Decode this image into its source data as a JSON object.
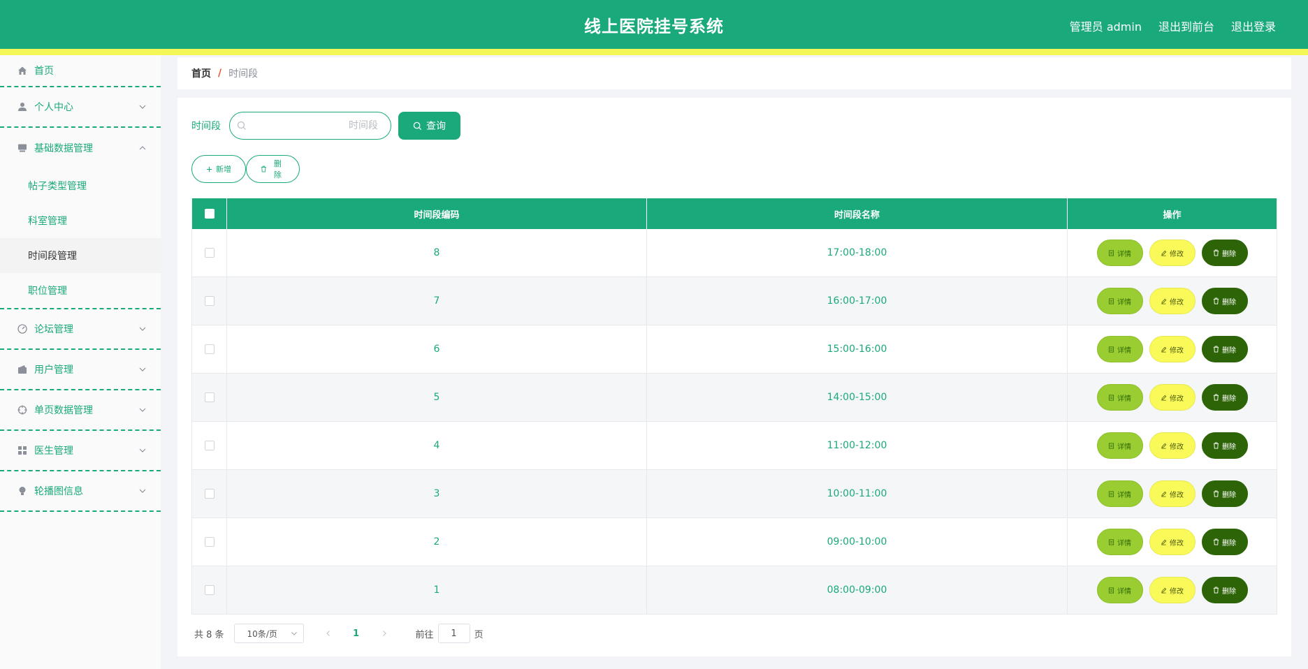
{
  "header": {
    "title": "线上医院挂号系统",
    "admin_label": "管理员 admin",
    "back_to_front": "退出到前台",
    "logout": "退出登录",
    "colors": {
      "primary": "#1aa97b",
      "strip": "#f5f758"
    }
  },
  "sidebar": {
    "items": [
      {
        "label": "首页",
        "icon": "home-icon"
      },
      {
        "label": "个人中心",
        "icon": "user-icon"
      },
      {
        "label": "基础数据管理",
        "icon": "archive-icon",
        "expanded": true,
        "children": [
          {
            "label": "帖子类型管理"
          },
          {
            "label": "科室管理"
          },
          {
            "label": "时间段管理",
            "active": true
          },
          {
            "label": "职位管理"
          }
        ]
      },
      {
        "label": "论坛管理",
        "icon": "gauge-icon"
      },
      {
        "label": "用户管理",
        "icon": "wallet-icon"
      },
      {
        "label": "单页数据管理",
        "icon": "crosshair-icon"
      },
      {
        "label": "医生管理",
        "icon": "grid-icon"
      },
      {
        "label": "轮播图信息",
        "icon": "bulb-icon"
      }
    ]
  },
  "breadcrumb": {
    "home": "首页",
    "separator": "/",
    "current": "时间段"
  },
  "search": {
    "label": "时间段",
    "placeholder": "时间段",
    "value": "",
    "query_button": "查询"
  },
  "actions": {
    "add": "新增",
    "delete": "删除"
  },
  "table": {
    "columns": [
      "时间段编码",
      "时间段名称",
      "操作"
    ],
    "rows": [
      {
        "code": "8",
        "name": "17:00-18:00"
      },
      {
        "code": "7",
        "name": "16:00-17:00"
      },
      {
        "code": "6",
        "name": "15:00-16:00"
      },
      {
        "code": "5",
        "name": "14:00-15:00"
      },
      {
        "code": "4",
        "name": "11:00-12:00"
      },
      {
        "code": "3",
        "name": "10:00-11:00"
      },
      {
        "code": "2",
        "name": "09:00-10:00"
      },
      {
        "code": "1",
        "name": "08:00-09:00"
      }
    ],
    "row_buttons": {
      "detail": "详情",
      "edit": "修改",
      "delete": "删除"
    }
  },
  "pagination": {
    "total": "共 8 条",
    "page_size": "10条/页",
    "current_page": "1",
    "goto_prefix": "前往",
    "goto_value": "1",
    "goto_suffix": "页"
  }
}
